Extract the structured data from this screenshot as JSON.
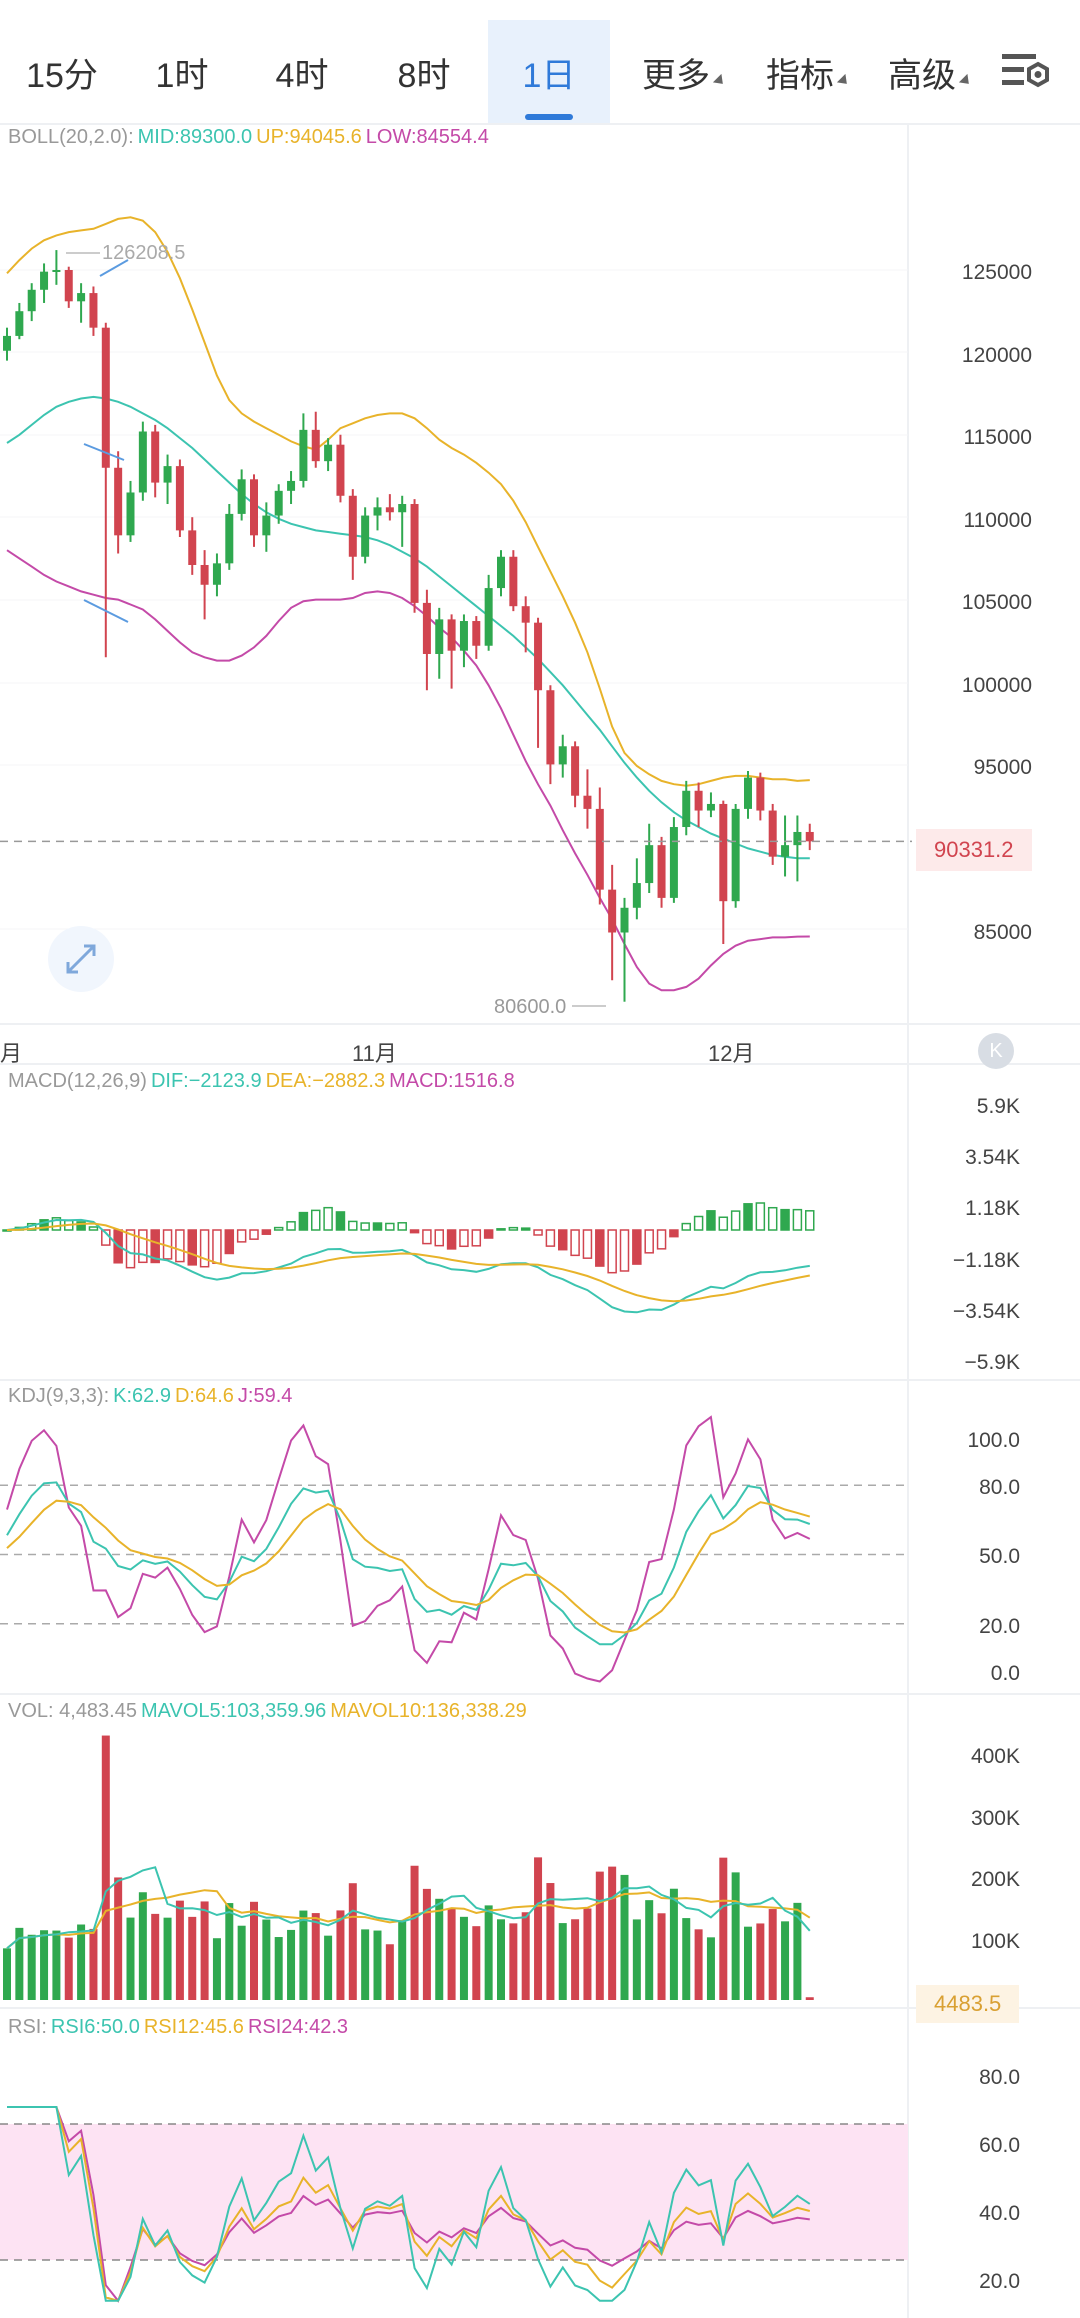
{
  "timeframes": {
    "tabs": [
      {
        "label": "15分",
        "active": false,
        "dropdown": false
      },
      {
        "label": "1时",
        "active": false,
        "dropdown": false
      },
      {
        "label": "4时",
        "active": false,
        "dropdown": false
      },
      {
        "label": "8时",
        "active": false,
        "dropdown": false
      },
      {
        "label": "1日",
        "active": true,
        "dropdown": false
      },
      {
        "label": "更多",
        "active": false,
        "dropdown": true
      },
      {
        "label": "指标",
        "active": false,
        "dropdown": true
      },
      {
        "label": "高级",
        "active": false,
        "dropdown": true
      }
    ],
    "settings_icon": "chart-settings-icon"
  },
  "colors": {
    "up": "#2fa84f",
    "down": "#d1444f",
    "mid": "#3cc4b0",
    "upper": "#e8b32a",
    "lower": "#c44aa8",
    "accent": "#2f7ad9"
  },
  "boll": {
    "name": "BOLL(20,2.0):",
    "mid": "MID:89300.0",
    "up": "UP:94045.6",
    "low": "LOW:84554.4",
    "y_ticks": [
      "125000",
      "120000",
      "115000",
      "110000",
      "105000",
      "100000",
      "95000",
      "85000"
    ],
    "current_price": "90331.2",
    "high_marker": "126208.5",
    "low_marker": "80600.0"
  },
  "date_labels": [
    "月",
    "11月",
    "12月"
  ],
  "macd": {
    "name": "MACD(12,26,9)",
    "dif": "DIF:−2123.9",
    "dea": "DEA:−2882.3",
    "macd": "MACD:1516.8",
    "y_ticks": [
      "5.9K",
      "3.54K",
      "1.18K",
      "−1.18K",
      "−3.54K",
      "−5.9K"
    ]
  },
  "kdj": {
    "name": "KDJ(9,3,3):",
    "k": "K:62.9",
    "d": "D:64.6",
    "j": "J:59.4",
    "y_ticks": [
      "100.0",
      "80.0",
      "50.0",
      "20.0",
      "0.0"
    ]
  },
  "vol": {
    "name": "VOL: 4,483.45",
    "mavol5": "MAVOL5:103,359.96",
    "mavol10": "MAVOL10:136,338.29",
    "y_ticks": [
      "400K",
      "300K",
      "200K",
      "100K"
    ],
    "current": "4483.5"
  },
  "rsi": {
    "name": "RSI:",
    "rsi6": "RSI6:50.0",
    "rsi12": "RSI12:45.6",
    "rsi24": "RSI24:42.3",
    "y_ticks": [
      "80.0",
      "60.0",
      "40.0",
      "20.0"
    ]
  },
  "chart_data": {
    "type": "candlestick",
    "candles": [
      [
        120100,
        121500,
        119500,
        121000
      ],
      [
        121000,
        123000,
        120800,
        122500
      ],
      [
        122500,
        124200,
        121900,
        123800
      ],
      [
        123800,
        125400,
        123000,
        124900
      ],
      [
        124900,
        126208.5,
        124100,
        125000
      ],
      [
        125000,
        125200,
        122700,
        123100
      ],
      [
        123100,
        124200,
        121800,
        123600
      ],
      [
        123600,
        124000,
        121000,
        121500
      ],
      [
        121500,
        121800,
        101500,
        113000
      ],
      [
        113000,
        114000,
        107800,
        108900
      ],
      [
        108900,
        112200,
        108500,
        111500
      ],
      [
        111500,
        115800,
        111000,
        115200
      ],
      [
        115200,
        115600,
        111200,
        112100
      ],
      [
        112100,
        113800,
        110800,
        113100
      ],
      [
        113100,
        113500,
        108800,
        109200
      ],
      [
        109200,
        110000,
        106500,
        107100
      ],
      [
        107100,
        108000,
        103800,
        105900
      ],
      [
        105900,
        107800,
        105200,
        107200
      ],
      [
        107200,
        110800,
        106800,
        110200
      ],
      [
        110200,
        112900,
        109800,
        112300
      ],
      [
        112300,
        112600,
        108200,
        108900
      ],
      [
        108900,
        110900,
        107900,
        110100
      ],
      [
        110100,
        112000,
        109600,
        111600
      ],
      [
        111600,
        112800,
        110800,
        112200
      ],
      [
        112200,
        116300,
        111800,
        115300
      ],
      [
        115300,
        116400,
        113000,
        113400
      ],
      [
        113400,
        114800,
        112800,
        114400
      ],
      [
        114400,
        115000,
        110900,
        111300
      ],
      [
        111300,
        111700,
        106200,
        107600
      ],
      [
        107600,
        110600,
        107200,
        110100
      ],
      [
        110100,
        111200,
        109200,
        110600
      ],
      [
        110600,
        111400,
        109800,
        110300
      ],
      [
        110300,
        111300,
        108200,
        110800
      ],
      [
        110800,
        111100,
        104200,
        104800
      ],
      [
        104800,
        105600,
        99500,
        101700
      ],
      [
        101700,
        104500,
        100200,
        103800
      ],
      [
        103800,
        104100,
        99600,
        101900
      ],
      [
        101900,
        104100,
        100900,
        103700
      ],
      [
        103700,
        104000,
        101400,
        102200
      ],
      [
        102200,
        106500,
        101900,
        105700
      ],
      [
        105700,
        108000,
        105200,
        107600
      ],
      [
        107600,
        108000,
        104300,
        104600
      ],
      [
        104600,
        105200,
        101800,
        103600
      ],
      [
        103600,
        103900,
        96000,
        99500
      ],
      [
        99500,
        99800,
        93800,
        95000
      ],
      [
        95000,
        96800,
        94200,
        96100
      ],
      [
        96100,
        96400,
        92400,
        93100
      ],
      [
        93100,
        94700,
        91100,
        92300
      ],
      [
        92300,
        93600,
        86500,
        87400
      ],
      [
        87400,
        88900,
        81900,
        84800
      ],
      [
        84800,
        86900,
        80600,
        86300
      ],
      [
        86300,
        89300,
        85600,
        87800
      ],
      [
        87800,
        91400,
        87200,
        90100
      ],
      [
        90100,
        90600,
        86300,
        86900
      ],
      [
        86900,
        91800,
        86600,
        91200
      ],
      [
        91200,
        94000,
        90700,
        93400
      ],
      [
        93400,
        93900,
        91200,
        92200
      ],
      [
        92200,
        93300,
        91800,
        92600
      ],
      [
        92600,
        92800,
        84100,
        86700
      ],
      [
        86700,
        92600,
        86300,
        92300
      ],
      [
        92300,
        94600,
        91700,
        94200
      ],
      [
        94200,
        94500,
        91600,
        92200
      ],
      [
        92200,
        92600,
        88900,
        89400
      ],
      [
        89400,
        91900,
        88200,
        90100
      ],
      [
        90100,
        91900,
        87900,
        90900
      ],
      [
        90900,
        91400,
        89800,
        90331.2
      ]
    ],
    "boll_mid": [
      114500,
      115000,
      115600,
      116200,
      116700,
      117000,
      117200,
      117300,
      117200,
      117000,
      116700,
      116300,
      115900,
      115400,
      114800,
      114200,
      113500,
      112800,
      112100,
      111400,
      110800,
      110300,
      109900,
      109600,
      109400,
      109200,
      109100,
      109000,
      108900,
      108800,
      108600,
      108300,
      107900,
      107500,
      107000,
      106400,
      105800,
      105200,
      104600,
      104000,
      103400,
      102800,
      102100,
      101400,
      100600,
      99800,
      98900,
      98000,
      97100,
      96100,
      95100,
      94200,
      93400,
      92700,
      92100,
      91600,
      91200,
      90800,
      90500,
      90200,
      89900,
      89700,
      89500,
      89400,
      89300,
      89300
    ],
    "boll_upper": [
      124800,
      125600,
      126300,
      126800,
      127100,
      127300,
      127400,
      127500,
      127800,
      128100,
      128200,
      128000,
      127300,
      126100,
      124500,
      122600,
      120600,
      118600,
      117100,
      116300,
      115800,
      115400,
      115000,
      114600,
      114300,
      114100,
      114700,
      115400,
      115700,
      116000,
      116200,
      116300,
      116300,
      116000,
      115400,
      114700,
      114200,
      113800,
      113300,
      112700,
      112000,
      111000,
      109700,
      108200,
      106700,
      105200,
      103600,
      101800,
      99600,
      97300,
      95700,
      94900,
      94400,
      94000,
      93800,
      93700,
      93800,
      94000,
      94200,
      94300,
      94300,
      94200,
      94100,
      94100,
      94000,
      94045.6
    ],
    "boll_lower": [
      108000,
      107500,
      107000,
      106500,
      106100,
      105800,
      105500,
      105300,
      105100,
      105000,
      104700,
      104400,
      103800,
      103100,
      102400,
      101800,
      101500,
      101300,
      101300,
      101600,
      102100,
      102800,
      103700,
      104500,
      104900,
      105000,
      105000,
      105000,
      105100,
      105400,
      105500,
      105400,
      105100,
      104600,
      104000,
      103300,
      102700,
      101900,
      101000,
      99800,
      98400,
      96800,
      95200,
      93800,
      92500,
      91000,
      89600,
      88300,
      86900,
      85600,
      84100,
      82700,
      81700,
      81300,
      81300,
      81500,
      82000,
      82800,
      83500,
      84000,
      84300,
      84400,
      84500,
      84500,
      84550,
      84554.4
    ],
    "markers": {
      "high": "126208.5",
      "low": "80600.0",
      "last": "90331.2"
    }
  }
}
